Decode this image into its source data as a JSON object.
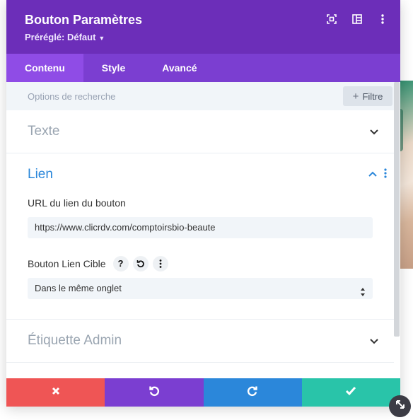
{
  "header": {
    "title": "Bouton Paramètres",
    "preset_label": "Préréglé: Défaut",
    "icons": [
      "expand-icon",
      "sidebar-layout-icon",
      "more-vertical-icon"
    ]
  },
  "tabs": [
    {
      "label": "Contenu",
      "active": true
    },
    {
      "label": "Style",
      "active": false
    },
    {
      "label": "Avancé",
      "active": false
    }
  ],
  "search": {
    "placeholder": "Options de recherche",
    "filter_label": "Filtre"
  },
  "sections": {
    "texte": {
      "title": "Texte",
      "expanded": false
    },
    "lien": {
      "title": "Lien",
      "expanded": true,
      "url_label": "URL du lien du bouton",
      "url_value": "https://www.clicrdv.com/comptoirsbio-beaute",
      "target_label": "Bouton Lien Cible",
      "target_value": "Dans le même onglet"
    },
    "admin": {
      "title": "Étiquette Admin",
      "expanded": false
    }
  },
  "footer": {
    "buttons": [
      "discard-icon",
      "undo-icon",
      "redo-icon",
      "save-icon"
    ]
  },
  "colors": {
    "header": "#6c2eb9",
    "tabs": "#7b3ed1",
    "active_tab": "#8f4ce6",
    "accent_blue": "#2b87da",
    "red": "#ef5555",
    "green": "#29c4a9"
  }
}
